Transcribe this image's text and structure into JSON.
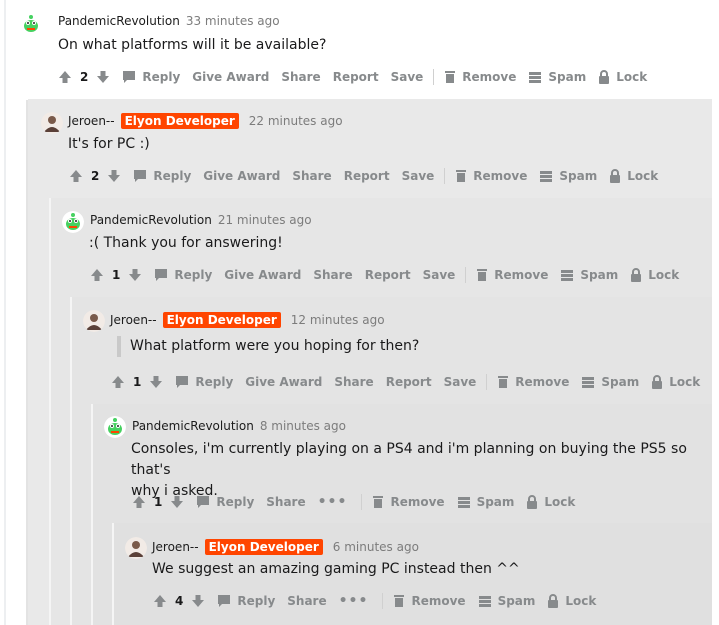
{
  "actions": {
    "reply": "Reply",
    "give_award": "Give Award",
    "share": "Share",
    "report": "Report",
    "save": "Save",
    "remove": "Remove",
    "spam": "Spam",
    "lock": "Lock",
    "more": "•••"
  },
  "comments": [
    {
      "username": "PandemicRevolution",
      "flair": "",
      "time": "33 minutes ago",
      "body": "On what platforms will it be available?",
      "votes": "2"
    },
    {
      "username": "Jeroen--",
      "flair": "Elyon Developer",
      "time": "22 minutes ago",
      "body": "It's for PC :)",
      "votes": "2"
    },
    {
      "username": "PandemicRevolution",
      "flair": "",
      "time": "21 minutes ago",
      "body": ":( Thank you for answering!",
      "votes": "1"
    },
    {
      "username": "Jeroen--",
      "flair": "Elyon Developer",
      "time": "12 minutes ago",
      "body": "What platform were you hoping for then?",
      "votes": "1"
    },
    {
      "username": "PandemicRevolution",
      "flair": "",
      "time": "8 minutes ago",
      "body_line1": "Consoles, i'm currently playing on a PS4 and i'm planning on buying the PS5 so that's",
      "body_line2": "why i asked.",
      "votes": "1"
    },
    {
      "username": "Jeroen--",
      "flair": "Elyon Developer",
      "time": "6 minutes ago",
      "body": "We suggest an amazing gaming PC instead then ^^",
      "votes": "4"
    }
  ],
  "colors": {
    "flair_bg": "#ff4500",
    "action_text": "#878a8c",
    "thread_bg": "#e9e9e9"
  }
}
